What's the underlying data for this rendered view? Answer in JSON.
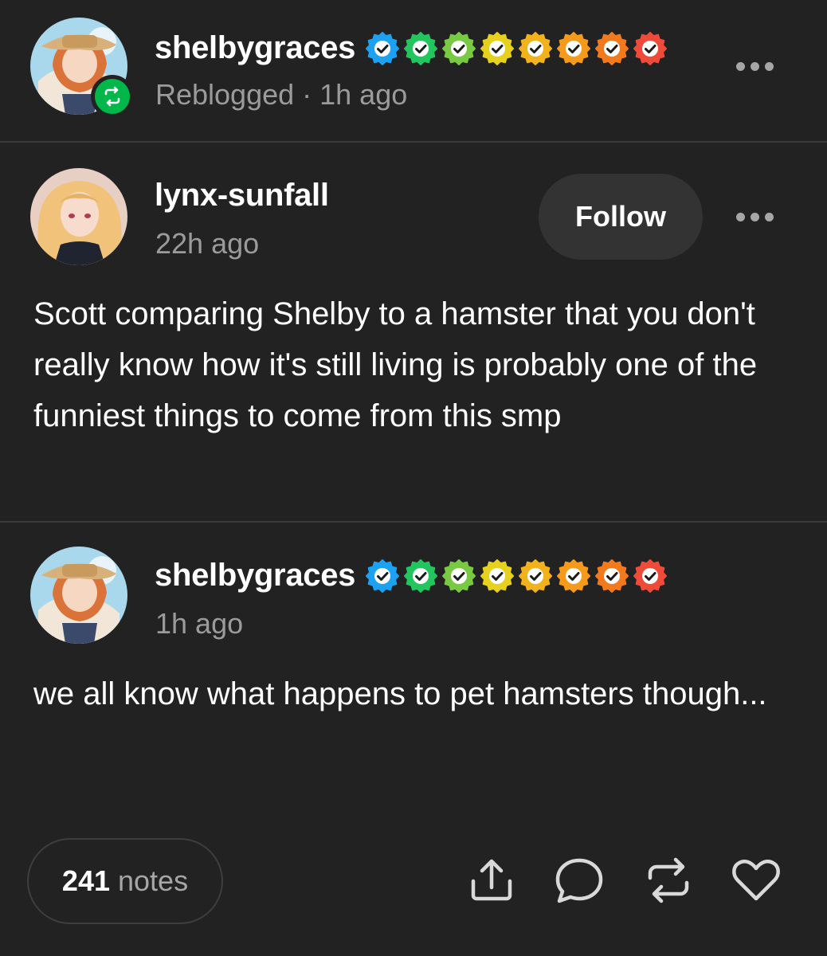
{
  "reblog_header": {
    "username": "shelbygraces",
    "status": "Reblogged · 1h ago",
    "verified_badge_colors": [
      "#1da1f2",
      "#22c55e",
      "#7ac943",
      "#e6d21e",
      "#f2b21c",
      "#f59a1b",
      "#f27a1c",
      "#ef4b3a"
    ]
  },
  "original_post": {
    "username": "lynx-sunfall",
    "time": "22h ago",
    "follow_label": "Follow",
    "text": "Scott comparing Shelby to a hamster that you don't really know how it's still living is probably one of the funniest things to come from this smp"
  },
  "reply_post": {
    "username": "shelbygraces",
    "time": "1h ago",
    "verified_badge_colors": [
      "#1da1f2",
      "#22c55e",
      "#7ac943",
      "#e6d21e",
      "#f2b21c",
      "#f59a1b",
      "#f27a1c",
      "#ef4b3a"
    ],
    "text": "we all know what happens to pet hamsters though..."
  },
  "footer": {
    "notes_count": "241",
    "notes_label": "notes",
    "actions": [
      "share-icon",
      "comment-icon",
      "reblog-icon",
      "heart-icon"
    ]
  },
  "colors": {
    "background": "#222222",
    "reblog_green": "#00b84a",
    "muted_text": "#9b9b9b"
  }
}
